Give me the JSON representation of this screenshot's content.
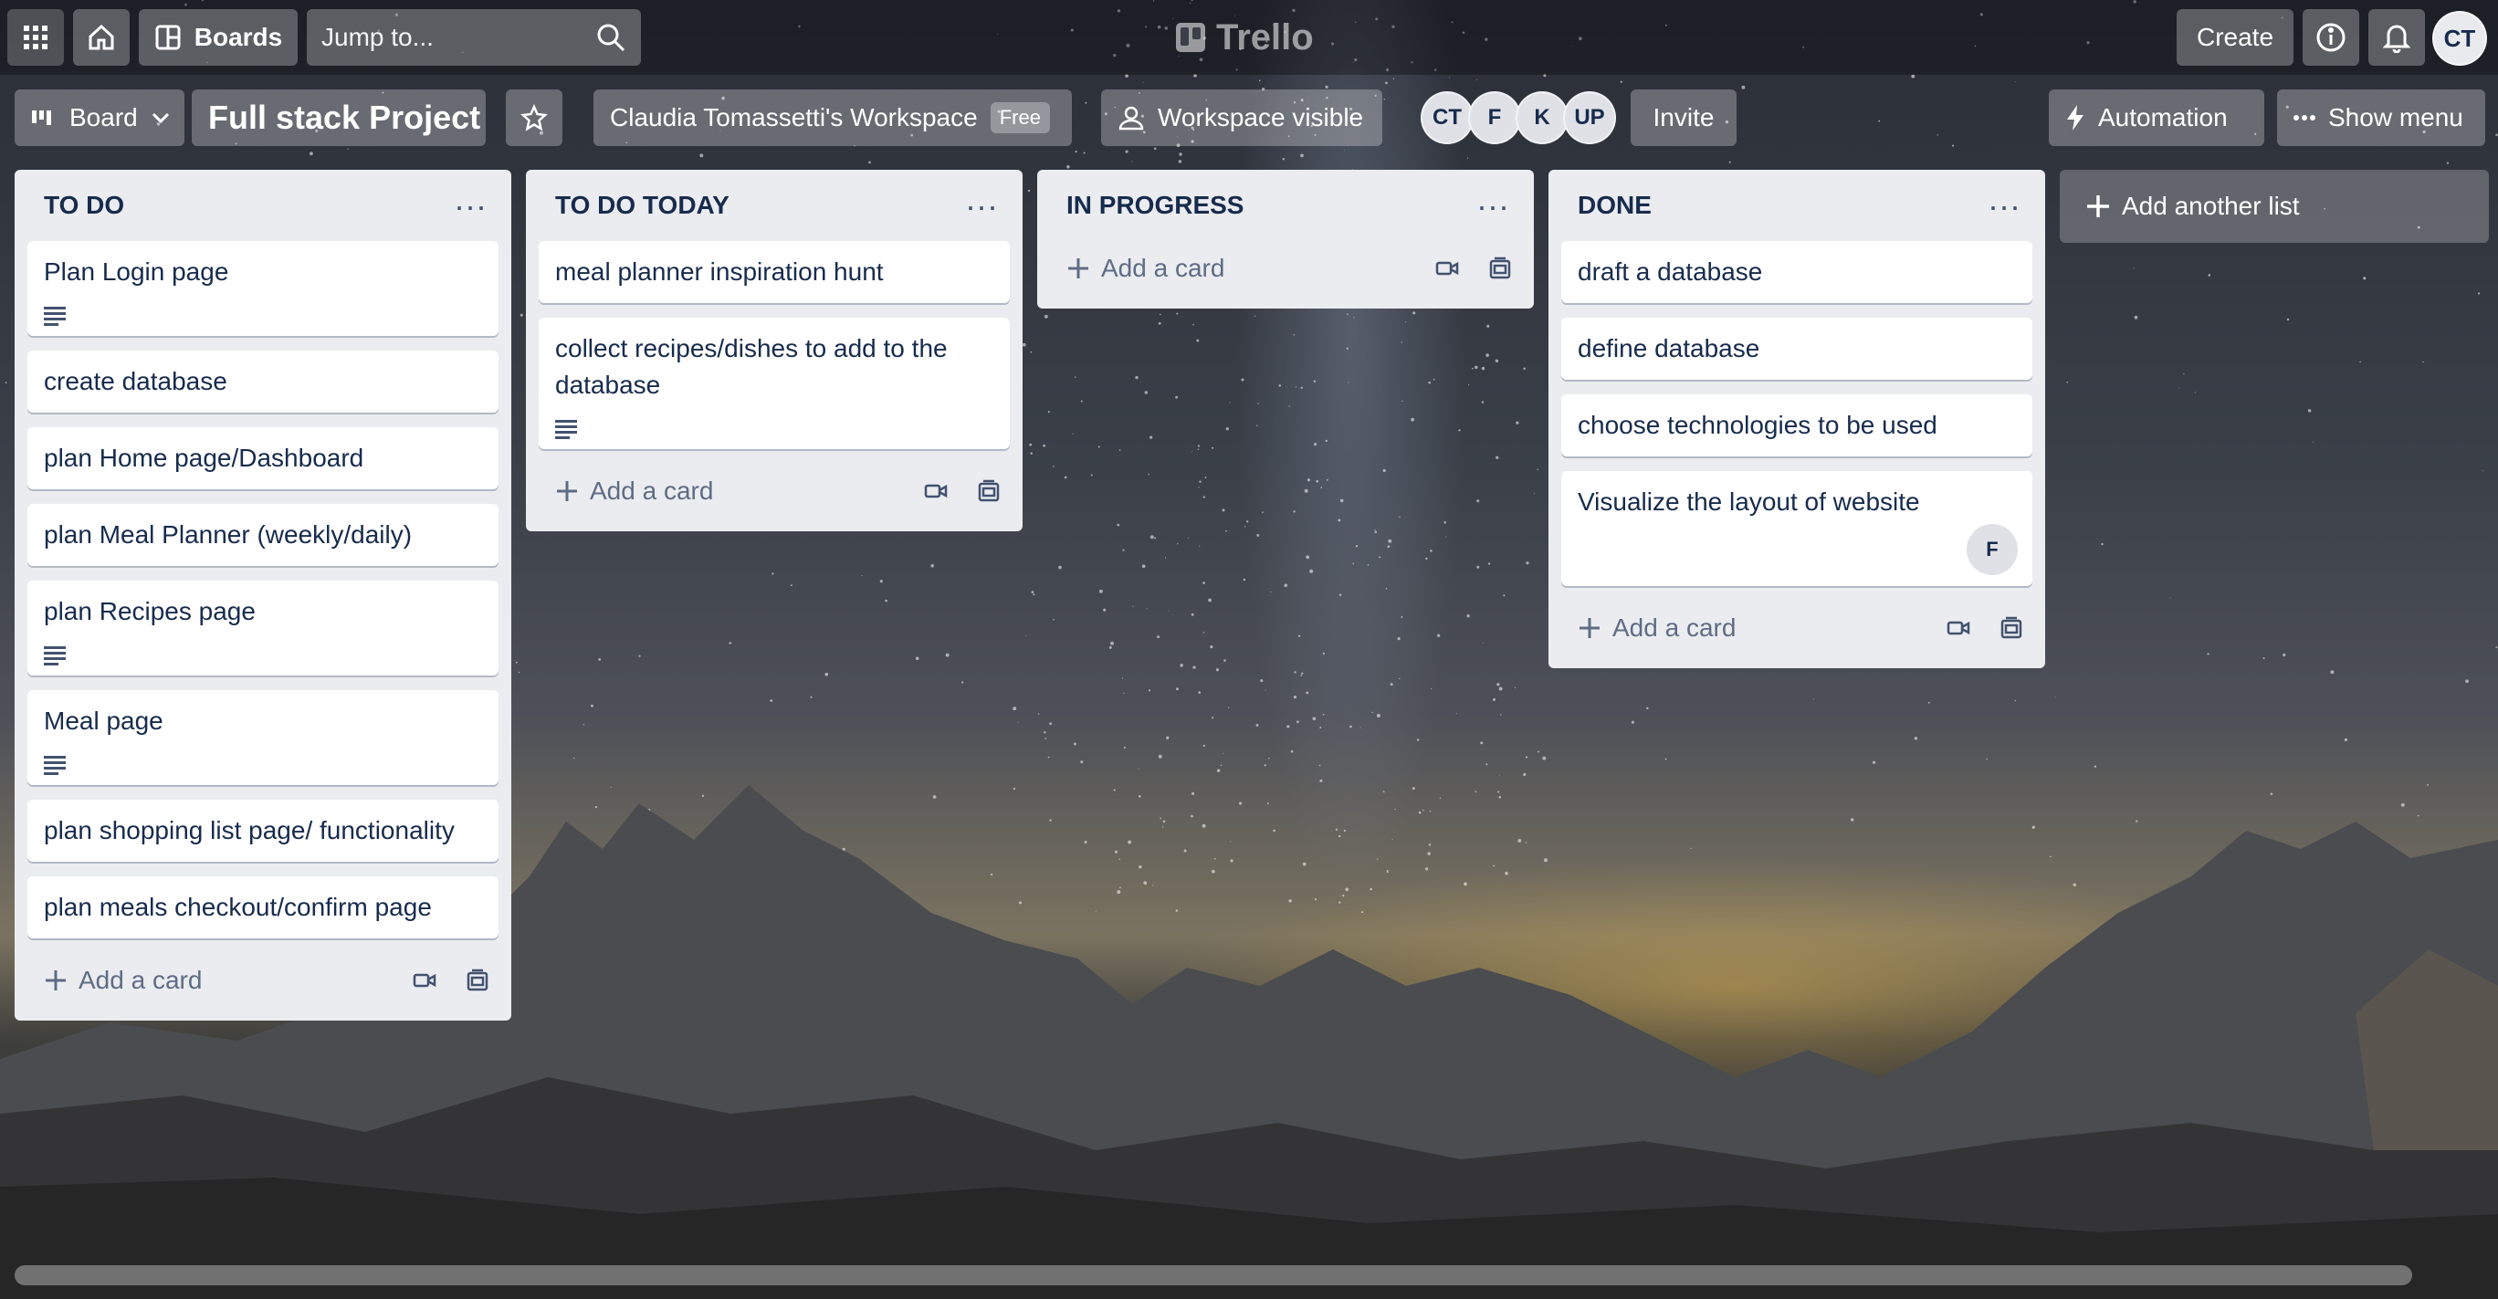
{
  "header": {
    "boards_label": "Boards",
    "search_placeholder": "Jump to...",
    "logo_text": "Trello",
    "create_label": "Create",
    "user_initials": "CT"
  },
  "board": {
    "view_label": "Board",
    "title": "Full stack Project",
    "workspace_name": "Claudia Tomassetti's Workspace",
    "workspace_plan": "Free",
    "visibility_label": "Workspace visible",
    "members": [
      "CT",
      "F",
      "K",
      "UP"
    ],
    "invite_label": "Invite",
    "automation_label": "Automation",
    "show_menu_label": "Show menu"
  },
  "lists": [
    {
      "title": "TO DO",
      "cards": [
        {
          "text": "Plan Login page"
        },
        {
          "text": "create database"
        },
        {
          "text": "plan Home page/Dashboard"
        },
        {
          "text": "plan Meal Planner (weekly/daily)"
        },
        {
          "text": "plan Recipes page"
        },
        {
          "text": "Meal page"
        },
        {
          "text": "plan shopping list page/ functionality"
        },
        {
          "text": "plan meals checkout/confirm page"
        }
      ]
    },
    {
      "title": "TO DO TODAY",
      "cards": [
        {
          "text": "meal planner inspiration hunt"
        },
        {
          "text": "collect recipes/dishes to add to the database"
        }
      ]
    },
    {
      "title": "IN PROGRESS",
      "cards": []
    },
    {
      "title": "DONE",
      "cards": [
        {
          "text": "draft a database"
        },
        {
          "text": "define database"
        },
        {
          "text": "choose technologies to be used"
        },
        {
          "text": "Visualize the layout of website",
          "member": "F"
        }
      ]
    }
  ],
  "add_card_label": "Add a card",
  "add_list_label": "Add another list",
  "colors": {
    "list_bg": "#ebecf0",
    "card_bg": "#ffffff",
    "text": "#172b4d",
    "muted": "#5e6c84"
  }
}
